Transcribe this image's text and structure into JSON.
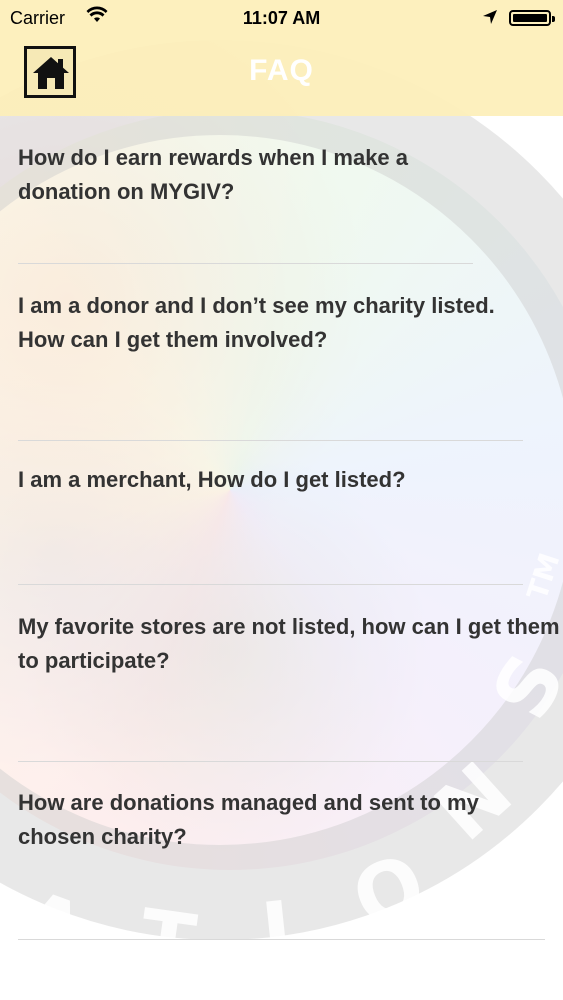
{
  "status_bar": {
    "carrier": "Carrier",
    "time": "11:07 AM"
  },
  "nav": {
    "title": "FAQ",
    "home_icon": "home-icon"
  },
  "faq": {
    "items": [
      {
        "question": "How do I earn rewards when I make a donation on MYGIV?"
      },
      {
        "question": "I am a donor and I don’t see my charity listed. How can I get them involved?"
      },
      {
        "question": "I am a merchant, How do I get listed?"
      },
      {
        "question": "My favorite stores are not listed, how can I get them to participate?"
      },
      {
        "question": "How are donations managed and sent to my chosen charity?"
      }
    ]
  },
  "watermark": {
    "letters": [
      "A",
      "T",
      "I",
      "O",
      "N",
      "S",
      "TM"
    ]
  }
}
